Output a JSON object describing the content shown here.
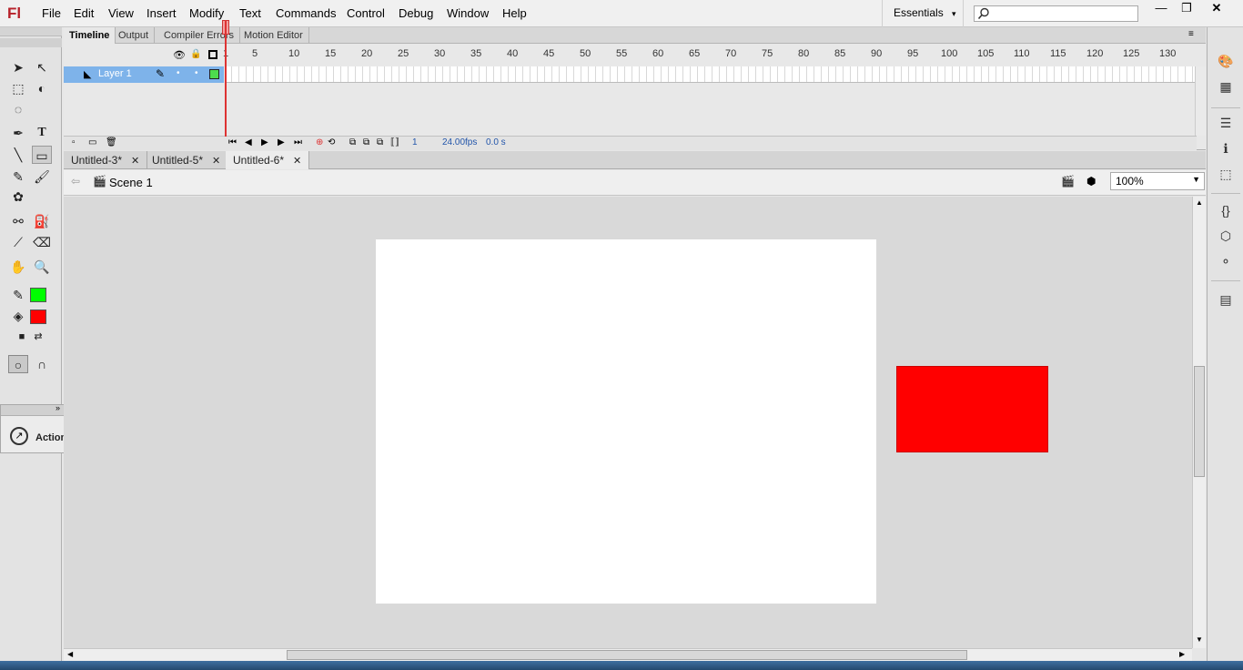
{
  "app": {
    "logo": "Fl"
  },
  "menu": [
    "File",
    "Edit",
    "View",
    "Insert",
    "Modify",
    "Text",
    "Commands",
    "Control",
    "Debug",
    "Window",
    "Help"
  ],
  "workspace": {
    "label": "Essentials",
    "arrow": "▾"
  },
  "window_controls": {
    "minimize": "—",
    "restore": "❐",
    "close": "✕"
  },
  "timeline": {
    "tabs": [
      "Timeline",
      "Output",
      "Compiler Errors",
      "Motion Editor"
    ],
    "ruler_ticks": [
      "1",
      "5",
      "10",
      "15",
      "20",
      "25",
      "30",
      "35",
      "40",
      "45",
      "50",
      "55",
      "60",
      "65",
      "70",
      "75",
      "80",
      "85",
      "90",
      "95",
      "100",
      "105",
      "110",
      "115",
      "120",
      "125",
      "130"
    ],
    "layer": {
      "name": "Layer 1"
    },
    "controls": {
      "frame": "1",
      "fps": "24.00",
      "fps_unit": "fps",
      "time": "0.0 s"
    }
  },
  "doc_tabs": [
    {
      "label": "Untitled-3*",
      "active": false
    },
    {
      "label": "Untitled-5*",
      "active": false
    },
    {
      "label": "Untitled-6*",
      "active": true
    }
  ],
  "editbar": {
    "scene": "Scene 1",
    "zoom": "100%"
  },
  "actions_panel": {
    "label": "Actions"
  },
  "colors": {
    "stroke": "#00ff00",
    "fill": "#ff0000",
    "stage": "#ffffff",
    "shape": "#ff0000"
  }
}
